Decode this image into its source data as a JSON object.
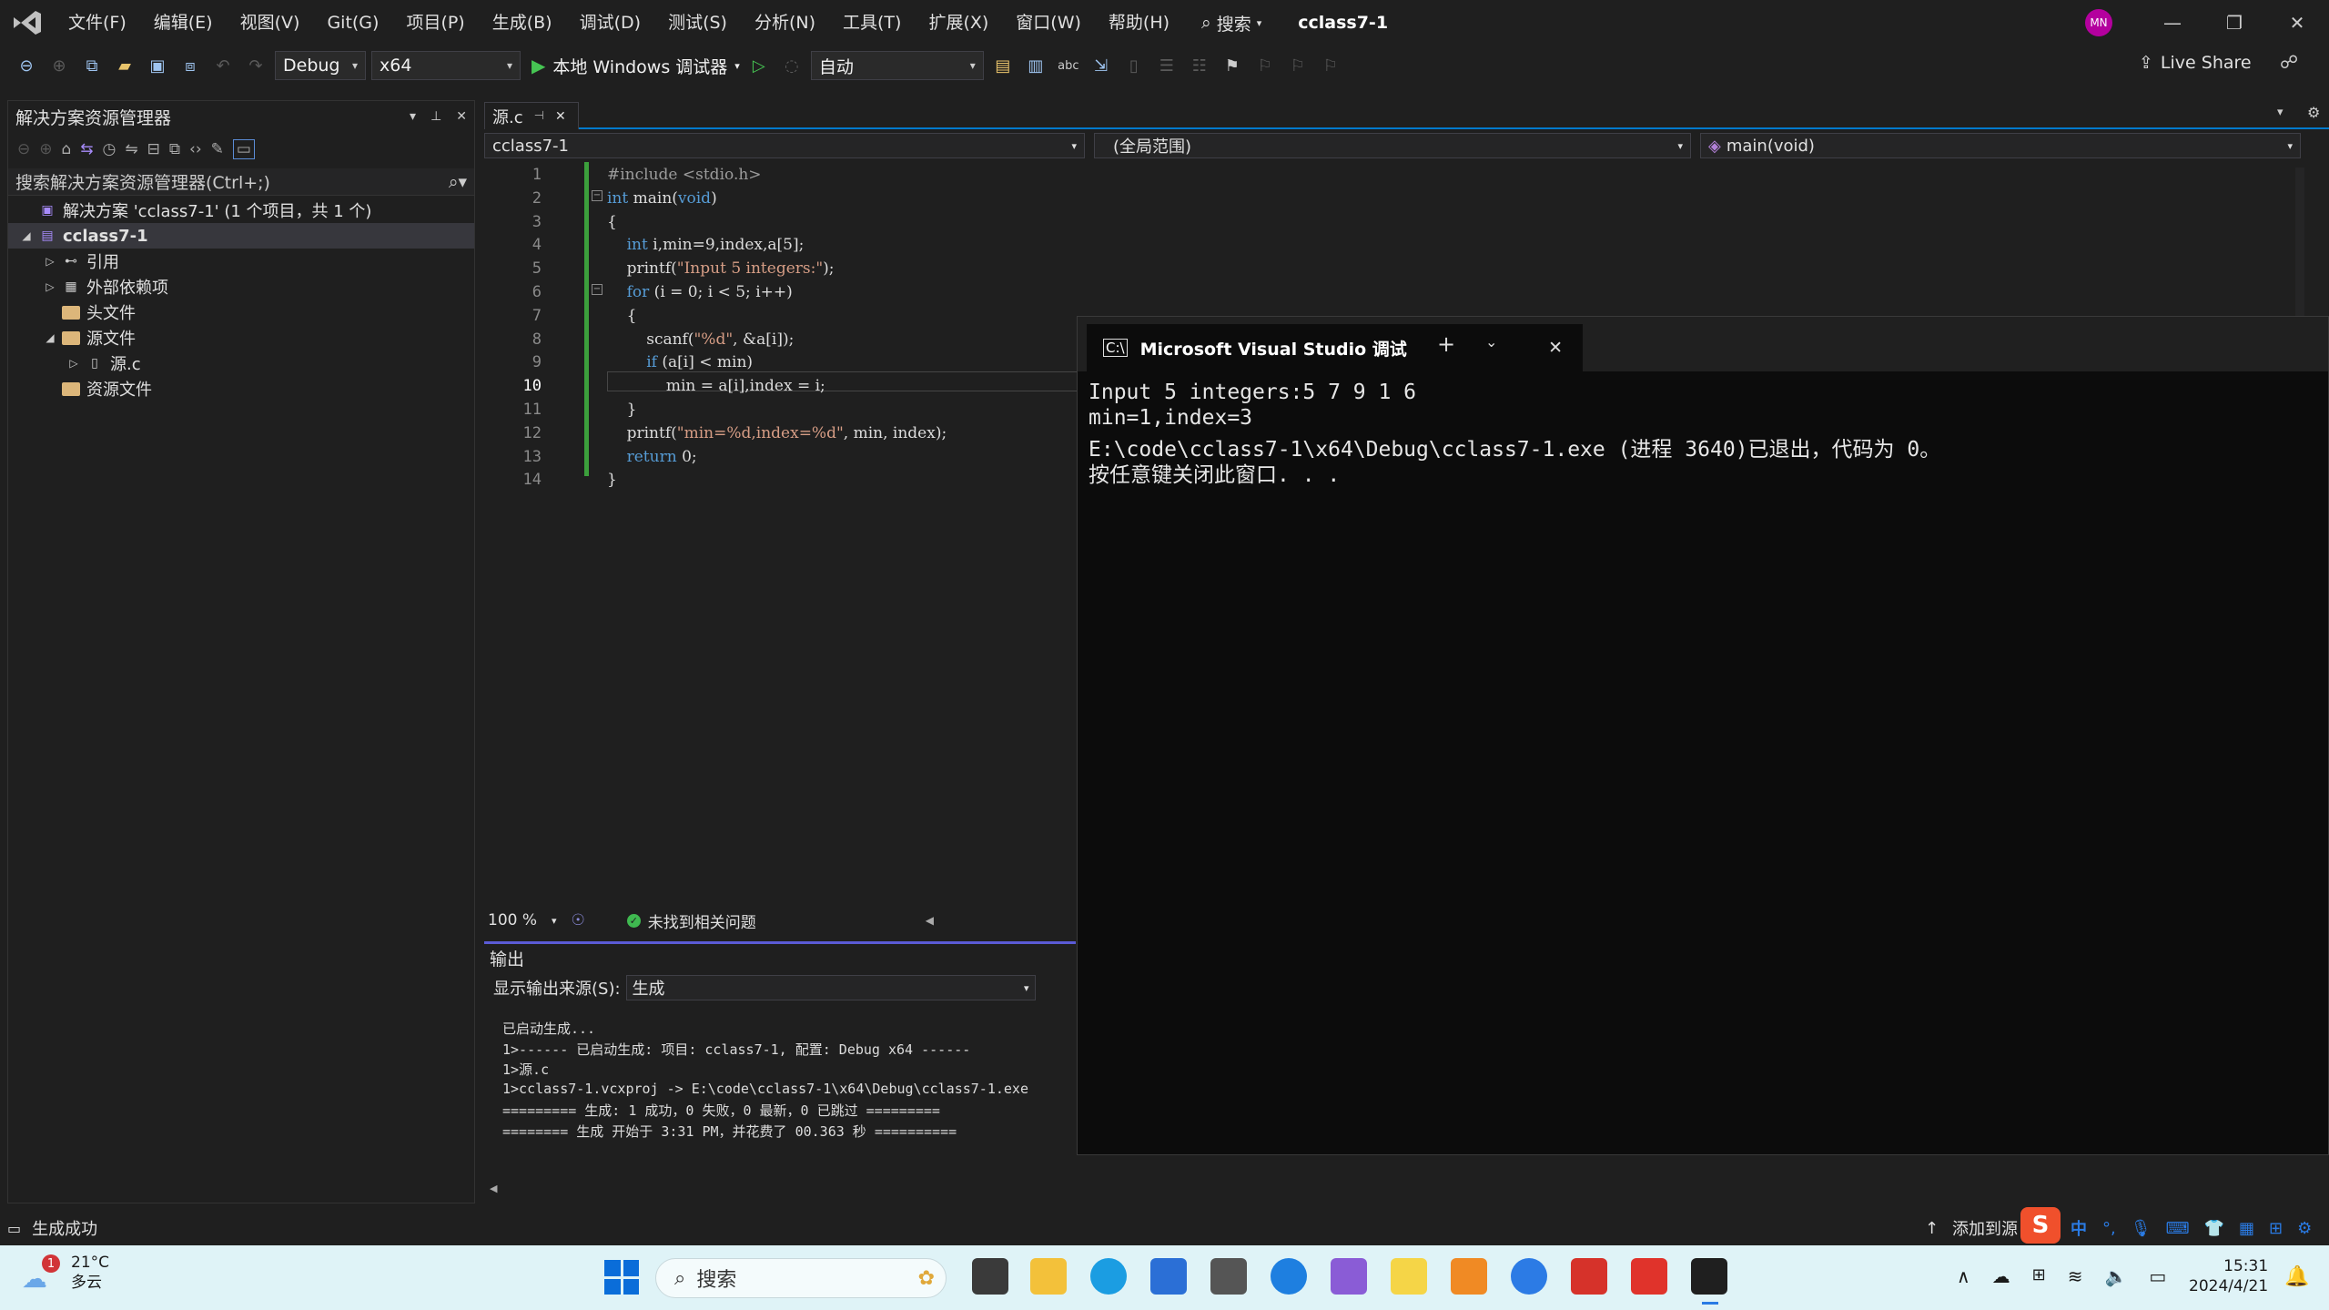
{
  "menu": {
    "items": [
      "文件(F)",
      "编辑(E)",
      "视图(V)",
      "Git(G)",
      "项目(P)",
      "生成(B)",
      "调试(D)",
      "测试(S)",
      "分析(N)",
      "工具(T)",
      "扩展(X)",
      "窗口(W)",
      "帮助(H)"
    ],
    "search_label": "搜索",
    "solution_title": "cclass7-1",
    "user_initials": "MN"
  },
  "toolbar": {
    "config": "Debug",
    "platform": "x64",
    "debugger": "本地 Windows 调试器",
    "mode": "自动",
    "live_share": "Live Share"
  },
  "solution_explorer": {
    "title": "解决方案资源管理器",
    "search_placeholder": "搜索解决方案资源管理器(Ctrl+;)",
    "tree": [
      {
        "label": "解决方案 'cclass7-1' (1 个项目，共 1 个)",
        "depth": 0,
        "icon": "solution-icon"
      },
      {
        "label": "cclass7-1",
        "depth": 0,
        "icon": "project-icon",
        "expanded": true,
        "selected": true
      },
      {
        "label": "引用",
        "depth": 1,
        "icon": "references-icon",
        "collapsed": true
      },
      {
        "label": "外部依赖项",
        "depth": 1,
        "icon": "external-deps-icon",
        "collapsed": true
      },
      {
        "label": "头文件",
        "depth": 1,
        "icon": "folder-icon"
      },
      {
        "label": "源文件",
        "depth": 1,
        "icon": "folder-icon",
        "expanded": true
      },
      {
        "label": "源.c",
        "depth": 2,
        "icon": "c-file-icon",
        "collapsed": true
      },
      {
        "label": "资源文件",
        "depth": 1,
        "icon": "folder-icon"
      }
    ]
  },
  "editor": {
    "tab_label": "源.c",
    "nav_project": "cclass7-1",
    "nav_scope": "(全局范围)",
    "nav_function": "main(void)",
    "current_line": 10,
    "zoom": "100 %",
    "issues": "未找到相关问题",
    "lines": [
      "#include <stdio.h>",
      "int main(void)",
      "{",
      "    int i,min=9,index,a[5];",
      "    printf(\"Input 5 integers:\");",
      "    for (i = 0; i < 5; i++)",
      "    {",
      "        scanf(\"%d\", &a[i]);",
      "        if (a[i] < min)",
      "            min = a[i],index = i;",
      "    }",
      "    printf(\"min=%d,index=%d\", min, index);",
      "    return 0;",
      "}"
    ]
  },
  "output": {
    "title": "输出",
    "source_label": "显示输出来源(S):",
    "source_value": "生成",
    "lines": [
      "已启动生成...",
      "1>------ 已启动生成: 项目: cclass7-1, 配置: Debug x64 ------",
      "1>源.c",
      "1>cclass7-1.vcxproj -> E:\\code\\cclass7-1\\x64\\Debug\\cclass7-1.exe",
      "========= 生成: 1 成功，0 失败，0 最新，0 已跳过 =========",
      "======== 生成 开始于 3:31 PM，并花费了 00.363 秒 =========="
    ]
  },
  "terminal": {
    "tab_title": "Microsoft Visual Studio 调试",
    "lines": [
      "Input 5 integers:5 7 9 1 6",
      "min=1,index=3",
      "E:\\code\\cclass7-1\\x64\\Debug\\cclass7-1.exe (进程 3640)已退出，代码为 0。",
      "按任意键关闭此窗口. . ."
    ]
  },
  "status": {
    "message": "生成成功",
    "source_control": "添加到源"
  },
  "taskbar": {
    "weather_temp": "21°C",
    "weather_desc": "多云",
    "weather_badge": "1",
    "search_label": "搜索",
    "ime": "中",
    "time": "15:31",
    "date": "2024/4/21"
  }
}
